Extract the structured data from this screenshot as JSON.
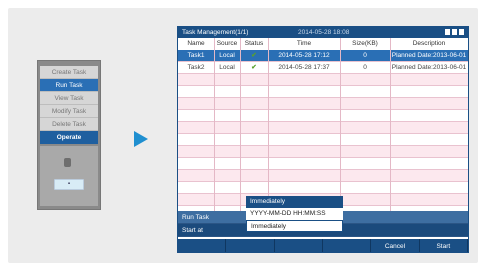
{
  "left_menu": {
    "items": [
      "Create Task",
      "Run Task",
      "View Task",
      "Modify Task",
      "Delete Task"
    ],
    "active_index": 1,
    "operate_label": "Operate"
  },
  "screen": {
    "title": "Task Management(1/1)",
    "datetime": "2014-05-28 18:08",
    "columns": [
      "Name",
      "Source",
      "Status",
      "Time",
      "Size(KB)",
      "Description"
    ],
    "rows": [
      {
        "name": "Task1",
        "source": "Local",
        "time": "2014-05-28 17:12",
        "size": "0",
        "description": "Planned Date:2013-06-01"
      },
      {
        "name": "Task2",
        "source": "Local",
        "time": "2014-05-28 17:37",
        "size": "0",
        "description": "Planned Date:2013-06-01"
      }
    ],
    "run_task_label": "Run Task",
    "start_at_label": "Start at",
    "dropdown": {
      "options": [
        "Immediately",
        "YYYY-MM-DD HH:MM:SS"
      ],
      "selected": "Immediately"
    },
    "buttons": [
      "",
      "",
      "",
      "",
      "Cancel",
      "Start"
    ]
  },
  "colors": {
    "accent": "#1a4f85",
    "selected_row": "#2a6fb5",
    "arrow": "#1f8fd0"
  }
}
